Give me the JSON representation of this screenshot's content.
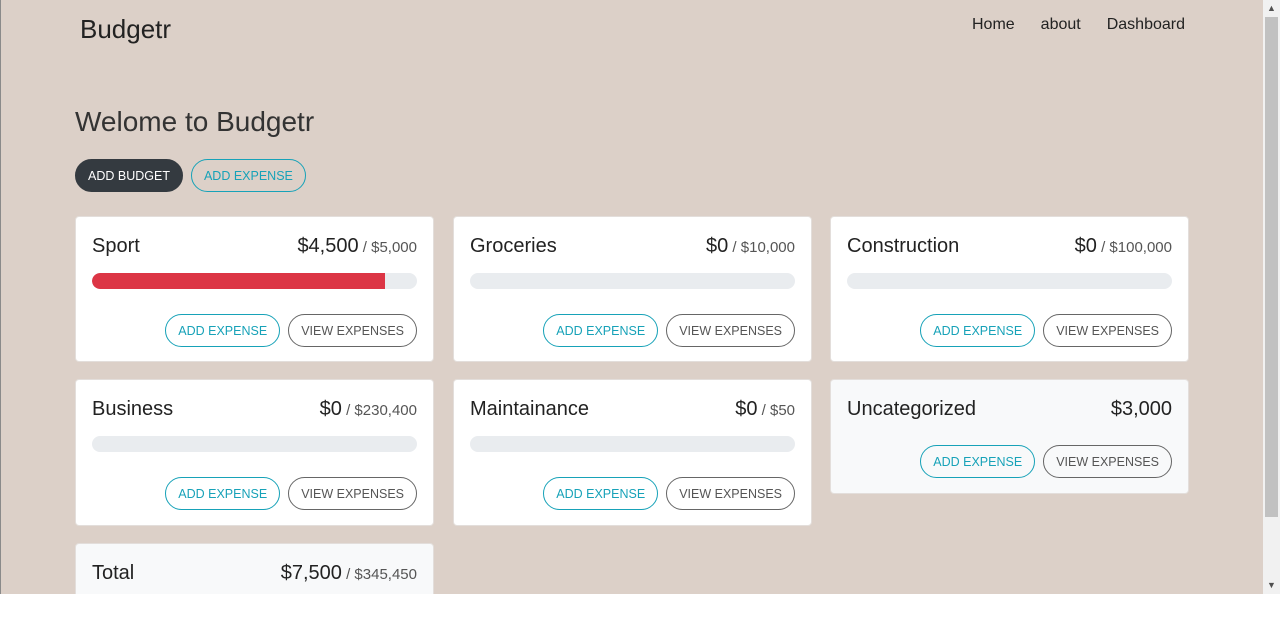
{
  "brand": "Budgetr",
  "nav": {
    "home": "Home",
    "about": "about",
    "dashboard": "Dashboard"
  },
  "welcome": "Welome to Budgetr",
  "actions": {
    "add_budget": "ADD BUDGET",
    "add_expense": "ADD EXPENSE"
  },
  "card_buttons": {
    "add_expense": "ADD EXPENSE",
    "view_expenses": "VIEW EXPENSES"
  },
  "colors": {
    "page_bg": "#dcd0c8",
    "danger": "#dc3545",
    "info": "#17a2b8",
    "dark": "#343a40"
  },
  "budgets": [
    {
      "name": "Sport",
      "amount": "$4,500",
      "limit": " / $5,000",
      "progress": 0.9
    },
    {
      "name": "Groceries",
      "amount": "$0",
      "limit": " / $10,000",
      "progress": 0
    },
    {
      "name": "Construction",
      "amount": "$0",
      "limit": " / $100,000",
      "progress": 0
    },
    {
      "name": "Business",
      "amount": "$0",
      "limit": " / $230,400",
      "progress": 0
    },
    {
      "name": "Maintainance",
      "amount": "$0",
      "limit": " / $50",
      "progress": 0
    }
  ],
  "uncategorized": {
    "name": "Uncategorized",
    "amount": "$3,000"
  },
  "total": {
    "name": "Total",
    "amount": "$7,500",
    "limit": " / $345,450"
  },
  "icons": {
    "scroll_up": "scroll-up-arrow-icon",
    "scroll_down": "scroll-down-arrow-icon"
  }
}
